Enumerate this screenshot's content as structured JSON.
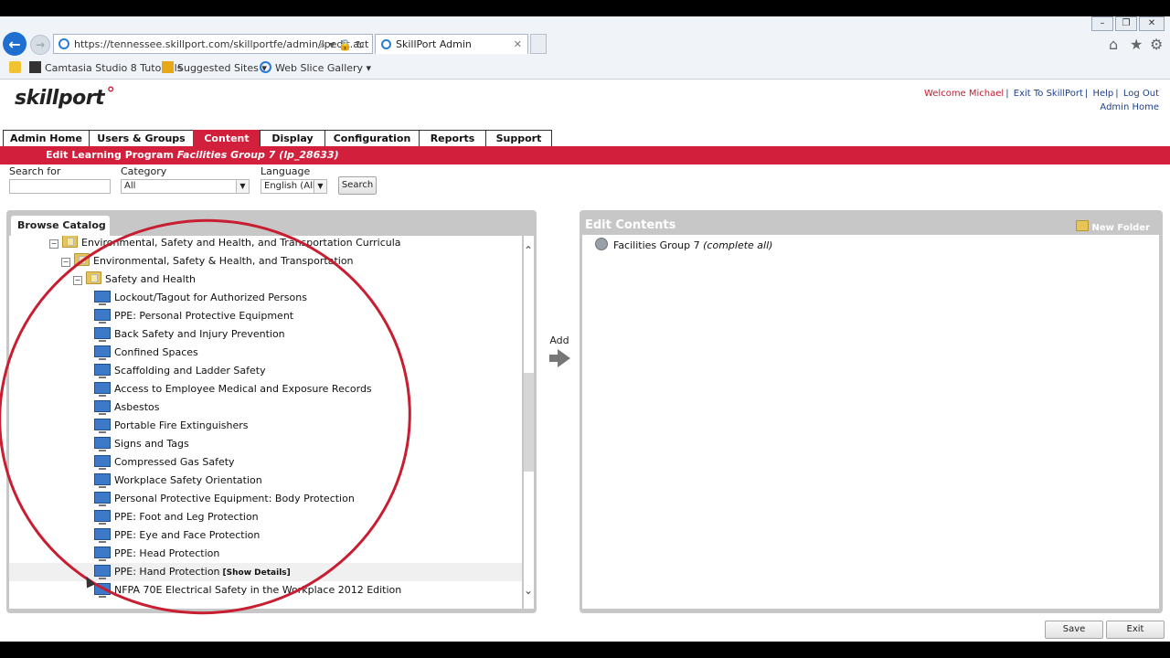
{
  "browser": {
    "url": "https://tennessee.skillport.com/skillportfe/admin/lpedit.act",
    "tab_title": "SkillPort Admin",
    "favorites": [
      "Camtasia Studio 8 Tutorials",
      "Suggested Sites ▾",
      "Web Slice Gallery ▾"
    ]
  },
  "app": {
    "logo": "skillport",
    "welcome": "Welcome Michael",
    "links": [
      "Exit To SkillPort",
      "Help",
      "Log Out"
    ],
    "admin_home_link": "Admin Home"
  },
  "nav": {
    "items": [
      "Admin Home",
      "Users & Groups",
      "Content",
      "Display",
      "Configuration",
      "Reports",
      "Support"
    ],
    "active": "Content"
  },
  "page_title": {
    "prefix": "Edit Learning Program ",
    "name": "Facilities Group 7 (lp_28633)"
  },
  "search": {
    "search_for_label": "Search for",
    "search_for_value": "",
    "category_label": "Category",
    "category_value": "All",
    "language_label": "Language",
    "language_value": "English (All)",
    "search_button": "Search"
  },
  "browse": {
    "title": "Browse Catalog",
    "tree": [
      {
        "label": "Environmental, Safety and Health, and Transportation Curricula",
        "type": "folder",
        "toggle": "−"
      },
      {
        "label": "Environmental, Safety & Health, and Transportation",
        "type": "folder",
        "toggle": "−"
      },
      {
        "label": "Safety and Health",
        "type": "folder",
        "toggle": "−"
      },
      {
        "label": "Lockout/Tagout for Authorized Persons",
        "type": "course"
      },
      {
        "label": "PPE: Personal Protective Equipment",
        "type": "course"
      },
      {
        "label": "Back Safety and Injury Prevention",
        "type": "course"
      },
      {
        "label": "Confined Spaces",
        "type": "course"
      },
      {
        "label": "Scaffolding and Ladder Safety",
        "type": "course"
      },
      {
        "label": "Access to Employee Medical and Exposure Records",
        "type": "course"
      },
      {
        "label": "Asbestos",
        "type": "course"
      },
      {
        "label": "Portable Fire Extinguishers",
        "type": "course"
      },
      {
        "label": "Signs and Tags",
        "type": "course"
      },
      {
        "label": "Compressed Gas Safety",
        "type": "course"
      },
      {
        "label": "Workplace Safety Orientation",
        "type": "course"
      },
      {
        "label": "Personal Protective Equipment: Body Protection",
        "type": "course"
      },
      {
        "label": "PPE: Foot and Leg Protection",
        "type": "course"
      },
      {
        "label": "PPE: Eye and Face Protection",
        "type": "course"
      },
      {
        "label": "PPE: Head Protection",
        "type": "course"
      },
      {
        "label": "PPE: Hand Protection",
        "type": "course",
        "details": "[Show Details]"
      },
      {
        "label": "NFPA 70E Electrical Safety in the Workplace 2012 Edition",
        "type": "course"
      }
    ]
  },
  "add_label": "Add",
  "edit": {
    "title": "Edit Contents",
    "new_folder": "New Folder",
    "program_name": "Facilities Group 7",
    "program_note": "(complete all)"
  },
  "footer": {
    "save": "Save",
    "exit": "Exit"
  },
  "colors": {
    "brand_red": "#d11f3c",
    "panel_gray": "#c7c7c7",
    "link_blue": "#1d3f8c"
  }
}
